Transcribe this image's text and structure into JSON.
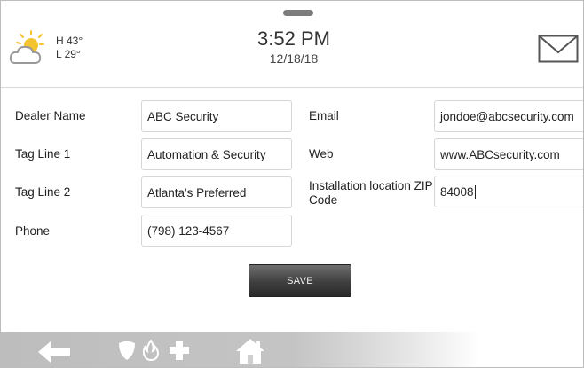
{
  "header": {
    "weather": {
      "icon": "partly-cloudy-icon",
      "high": "H 43°",
      "low": "L 29°"
    },
    "time": "3:52 PM",
    "date": "12/18/18",
    "mail_icon": "envelope-icon"
  },
  "form": {
    "dealer_name": {
      "label": "Dealer Name",
      "value": "ABC Security"
    },
    "tag_line_1": {
      "label": "Tag Line 1",
      "value": "Automation & Security"
    },
    "tag_line_2": {
      "label": "Tag Line 2",
      "value": "Atlanta's Preferred"
    },
    "phone": {
      "label": "Phone",
      "value": "(798) 123-4567"
    },
    "email": {
      "label": "Email",
      "value": "jondoe@abcsecurity.com"
    },
    "web": {
      "label": "Web",
      "value": "www.ABCsecurity.com"
    },
    "zip": {
      "label": "Installation location ZIP Code",
      "value": "84008"
    }
  },
  "save_label": "SAVE",
  "nav": {
    "back_icon": "back-arrow-icon",
    "security_icon": "shield-icon",
    "fire_icon": "flame-icon",
    "medical_icon": "medical-cross-icon",
    "home_icon": "home-icon"
  },
  "colors": {
    "accent_sun": "#f4c430",
    "nav_bg": "#c4c4c4",
    "button": "#3f3f3f"
  }
}
